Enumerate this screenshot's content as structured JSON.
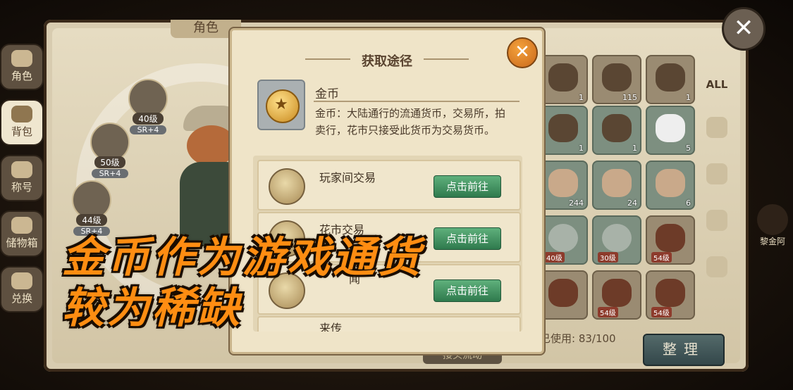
{
  "background_panel": {
    "title": "角色"
  },
  "side_tabs": [
    {
      "label": "角色",
      "icon": "character-icon",
      "active": false
    },
    {
      "label": "背包",
      "icon": "backpack-icon",
      "active": true
    },
    {
      "label": "称号",
      "icon": "title-icon",
      "active": false
    },
    {
      "label": "储物箱",
      "icon": "storage-icon",
      "active": false
    },
    {
      "label": "兑换",
      "icon": "exchange-icon",
      "active": false
    }
  ],
  "heroes": [
    {
      "level": "40级",
      "grade": "SR+4"
    },
    {
      "level": "50级",
      "grade": "SR+4"
    },
    {
      "level": "44级",
      "grade": "SR+4"
    }
  ],
  "inventory": {
    "slots": [
      {
        "count": "1",
        "icon": "fish-icon"
      },
      {
        "count": "115",
        "icon": "fish-icon"
      },
      {
        "count": "1",
        "icon": "fish-icon"
      },
      {
        "count": "1",
        "icon": "herb-icon"
      },
      {
        "count": "1",
        "icon": "fruit-icon"
      },
      {
        "count": "5",
        "icon": "flour-icon"
      },
      {
        "count": "244",
        "icon": "meat-icon"
      },
      {
        "count": "24",
        "icon": "meat-icon"
      },
      {
        "count": "6",
        "icon": "meat-icon"
      },
      {
        "count": "",
        "label": "40级",
        "icon": "ring-icon"
      },
      {
        "count": "",
        "label": "30级",
        "icon": "ring-icon"
      },
      {
        "count": "",
        "label": "54级",
        "icon": "scroll-icon"
      },
      {
        "count": "",
        "label": "",
        "icon": "scroll-icon"
      },
      {
        "count": "",
        "label": "54级",
        "icon": "scroll-icon"
      },
      {
        "count": "",
        "label": "54级",
        "icon": "scroll-icon"
      }
    ],
    "usage_label": "已使用: 83/100",
    "sort_button": "整理",
    "bottom_button": "接头流动"
  },
  "right_tabs": [
    {
      "label": "ALL"
    },
    {
      "label": "",
      "icon": "clothes-icon"
    },
    {
      "label": "",
      "icon": "box-icon"
    },
    {
      "label": "",
      "icon": "pot-icon"
    },
    {
      "label": "",
      "icon": "horse-icon"
    }
  ],
  "npc_label": "黎金阿",
  "modal": {
    "title": "获取途径",
    "item_name": "金币",
    "item_desc": "金币：大陆通行的流通货币，交易所，拍卖行，花市只接受此货币为交易货币。",
    "routes": [
      {
        "name": "玩家间交易",
        "button": "点击前往"
      },
      {
        "name": "花市交易",
        "button": "点击前往"
      },
      {
        "name": "闻",
        "button": "点击前往"
      },
      {
        "name": "来传",
        "button": ""
      }
    ]
  },
  "overlay_caption": {
    "line1": "金币作为游戏通货",
    "line2": "较为稀缺"
  },
  "colors": {
    "accent": "#ff8d12",
    "go_button": "#3e8f5e",
    "close_orange": "#e0862a"
  }
}
